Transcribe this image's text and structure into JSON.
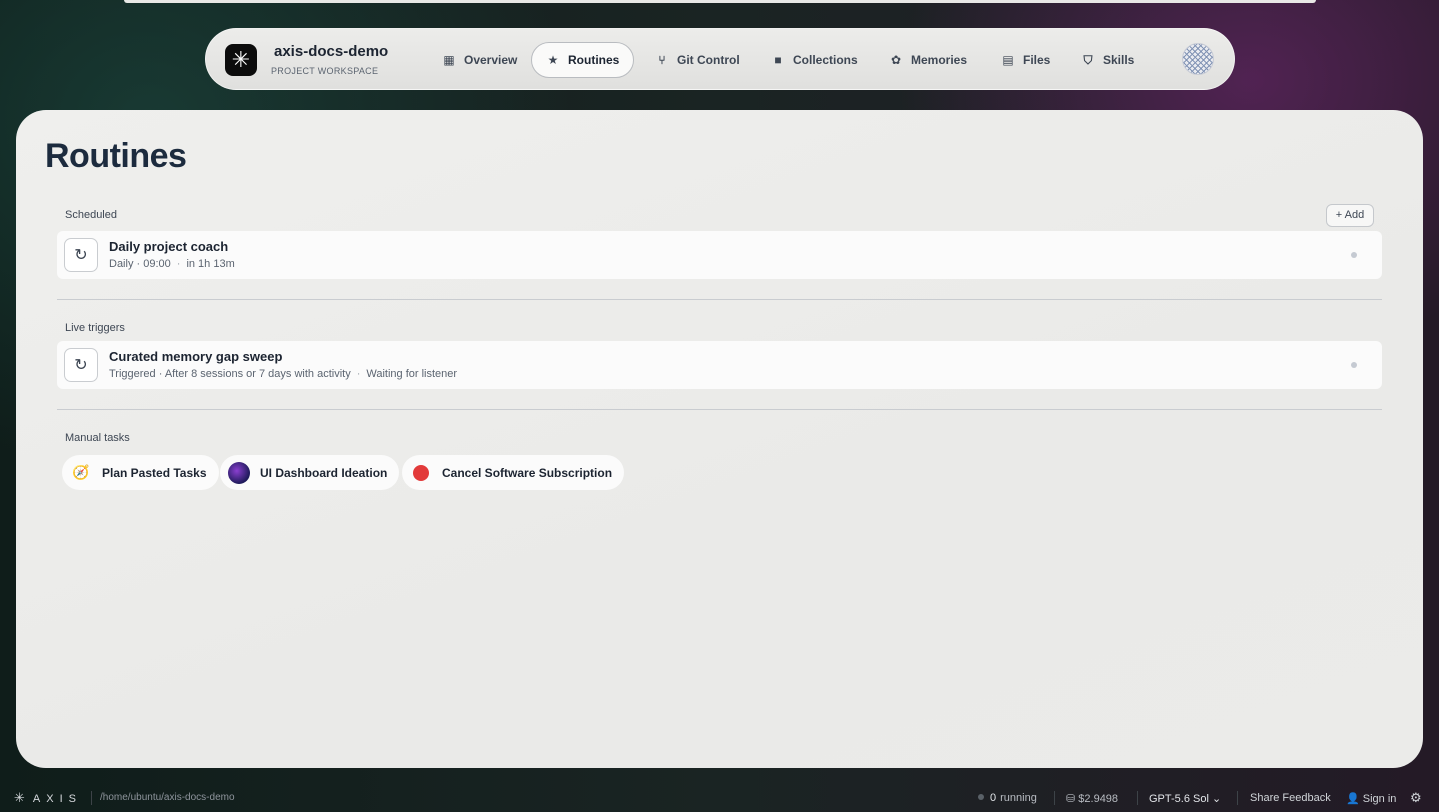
{
  "nav": {
    "project_name": "axis-docs-demo",
    "project_sub": "PROJECT WORKSPACE",
    "logo_icon": "asterisk-logo",
    "tabs": [
      {
        "label": "Overview",
        "icon": "grid-icon"
      },
      {
        "label": "Routines",
        "icon": "star-icon",
        "active": true
      },
      {
        "label": "Git Control",
        "icon": "git-branch-icon"
      },
      {
        "label": "Collections",
        "icon": "folder-icon"
      },
      {
        "label": "Memories",
        "icon": "brain-icon"
      },
      {
        "label": "Files",
        "icon": "file-icon"
      },
      {
        "label": "Skills",
        "icon": "shield-check-icon"
      }
    ]
  },
  "page": {
    "title": "Routines",
    "scheduled_label": "Scheduled",
    "add_label": "+ Add",
    "live_label": "Live triggers",
    "manual_label": "Manual tasks"
  },
  "scheduled": [
    {
      "title": "Daily project coach",
      "meta1": "Daily · 09:00",
      "meta2": "in 1h 13m"
    }
  ],
  "live": [
    {
      "title": "Curated memory gap sweep",
      "meta1": "Triggered · After 8 sessions or 7 days with activity",
      "meta2": "Waiting for listener"
    }
  ],
  "manual": [
    {
      "label": "Plan Pasted Tasks",
      "icon": "compass-icon"
    },
    {
      "label": "UI Dashboard Ideation",
      "icon": "avatar-icon"
    },
    {
      "label": "Cancel Software Subscription",
      "icon": "stop-icon"
    }
  ],
  "status": {
    "brand": "AXIS",
    "path": "/home/ubuntu/axis-docs-demo",
    "running_count": "0",
    "running_label": "running",
    "cost": "$2.9498",
    "model": "GPT-5.6 Sol",
    "feedback": "Share Feedback",
    "signin": "Sign in"
  }
}
